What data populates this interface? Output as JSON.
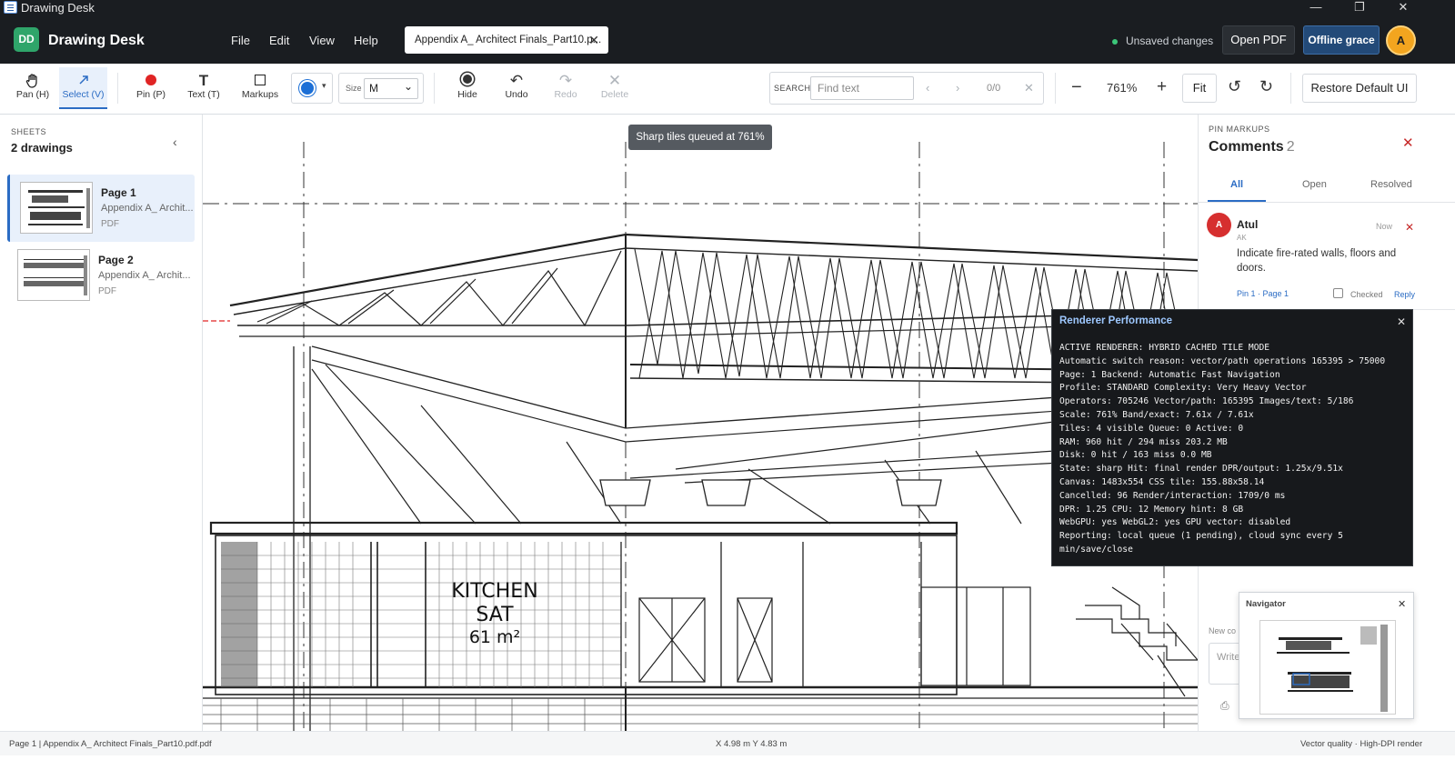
{
  "window": {
    "title": "Drawing Desk",
    "minimize": "—",
    "maximize": "❐",
    "close": "✕"
  },
  "header": {
    "logo_badge": "DD",
    "app_name": "Drawing Desk",
    "menu": [
      "File",
      "Edit",
      "View",
      "Help"
    ],
    "doc_tab": "Appendix A_ Architect Finals_Part10.p...",
    "unsaved": "Unsaved changes",
    "open_pdf": "Open PDF",
    "offline": "Offline grace",
    "avatar": "A"
  },
  "toolbar": {
    "pan": "Pan (H)",
    "select": "Select (V)",
    "pin": "Pin (P)",
    "text": "Text (T)",
    "markups": "Markups",
    "color": "#1c6fd6",
    "size_label": "Size",
    "size_value": "M",
    "hide": "Hide",
    "undo": "Undo",
    "redo": "Redo",
    "delete": "Delete",
    "search_label": "SEARCH",
    "search_placeholder": "Find text",
    "search_count": "0/0",
    "zoom": "761%",
    "fit": "Fit",
    "restore": "Restore Default UI"
  },
  "sidebar": {
    "label": "SHEETS",
    "count": "2 drawings",
    "sheets": [
      {
        "title": "Page 1",
        "subtitle": "Appendix A_ Archit...",
        "type": "PDF"
      },
      {
        "title": "Page 2",
        "subtitle": "Appendix A_ Archit...",
        "type": "PDF"
      }
    ]
  },
  "canvas": {
    "toast": "Sharp tiles queued at 761%",
    "room_name": "KITCHEN",
    "room_sub": "SAT",
    "room_area": "61 m²"
  },
  "perf": {
    "title": "Renderer Performance",
    "lines": [
      "ACTIVE RENDERER: HYBRID CACHED TILE MODE",
      "Automatic switch reason: vector/path operations 165395 > 75000",
      "Page: 1  Backend: Automatic Fast Navigation",
      "Profile: STANDARD  Complexity: Very Heavy Vector",
      "Operators: 705246  Vector/path: 165395  Images/text: 5/186",
      "Scale: 761%  Band/exact: 7.61x / 7.61x",
      "Tiles: 4 visible  Queue: 0  Active: 0",
      "RAM: 960 hit / 294 miss  203.2 MB",
      "Disk: 0 hit / 163 miss  0.0 MB",
      "State: sharp  Hit: final render  DPR/output: 1.25x/9.51x",
      "Canvas: 1483x554  CSS tile: 155.88x58.14",
      "Cancelled: 96  Render/interaction: 1709/0 ms",
      "DPR: 1.25  CPU: 12  Memory hint: 8 GB",
      "WebGPU: yes  WebGL2: yes  GPU vector: disabled",
      "Reporting: local queue (1 pending), cloud sync every 5",
      "min/save/close"
    ]
  },
  "comments": {
    "label": "PIN MARKUPS",
    "title": "Comments",
    "count": "2",
    "tabs": [
      "All",
      "Open",
      "Resolved"
    ],
    "items": [
      {
        "avatar": "A",
        "author": "Atul",
        "initials": "AK",
        "time": "Now",
        "body": "Indicate fire-rated walls, floors and doors.",
        "pin": "Pin 1 · Page 1",
        "checked_label": "Checked",
        "reply": "Reply"
      }
    ],
    "new_label": "New co",
    "new_placeholder": "Write"
  },
  "navigator": {
    "title": "Navigator"
  },
  "status": {
    "left": "Page 1 | Appendix A_ Architect Finals_Part10.pdf.pdf",
    "coords": "X 4.98 m   Y 4.83 m",
    "right": "Vector quality · High-DPI render"
  }
}
